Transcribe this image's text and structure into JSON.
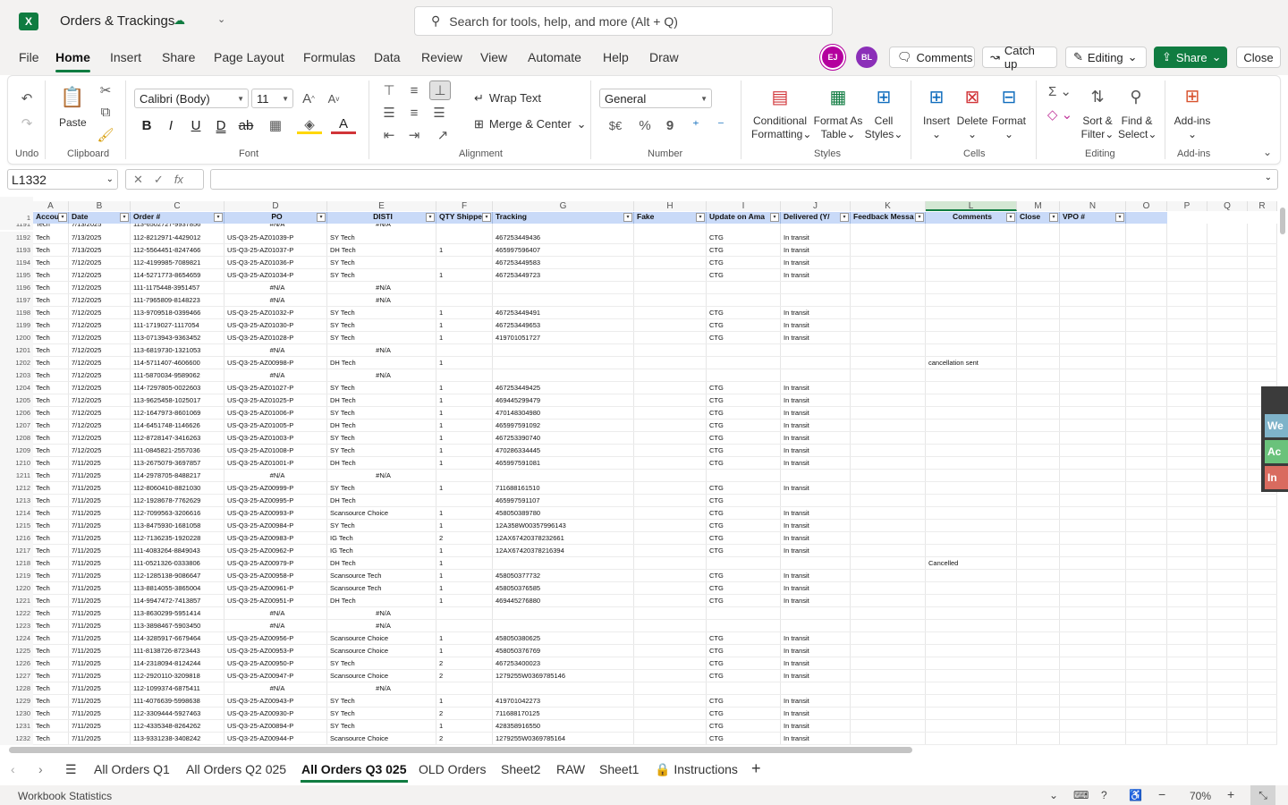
{
  "app": {
    "title": "Orders & Trackings",
    "search_placeholder": "Search for tools, help, and more (Alt + Q)"
  },
  "menu": [
    "File",
    "Home",
    "Insert",
    "Share",
    "Page Layout",
    "Formulas",
    "Data",
    "Review",
    "View",
    "Automate",
    "Help",
    "Draw"
  ],
  "header_buttons": {
    "avatar1": "EJ",
    "avatar2": "BL",
    "comments": "Comments",
    "catchup": "Catch up",
    "editing": "Editing",
    "share": "Share",
    "close": "Close"
  },
  "ribbon": {
    "paste": "Paste",
    "clipboard": "Clipboard",
    "undo": "Undo",
    "font_name": "Calibri (Body)",
    "font_size": "11",
    "font": "Font",
    "wrap": "Wrap Text",
    "merge": "Merge & Center",
    "alignment": "Alignment",
    "numfmt": "General",
    "number": "Number",
    "cond_fmt": "Conditional",
    "cond_fmt2": "Formatting",
    "fmt_table": "Format As",
    "fmt_table2": "Table",
    "cell_styles": "Cell",
    "cell_styles2": "Styles",
    "styles": "Styles",
    "insert": "Insert",
    "delete": "Delete",
    "format": "Format",
    "cells": "Cells",
    "sort": "Sort &",
    "sort2": "Filter",
    "find": "Find &",
    "find2": "Select",
    "editing": "Editing",
    "addins": "Add-ins",
    "addins_grp": "Add-ins"
  },
  "namebox": "L1332",
  "columns": [
    "A",
    "B",
    "C",
    "D",
    "E",
    "F",
    "G",
    "H",
    "I",
    "J",
    "K",
    "L",
    "M",
    "N",
    "O",
    "P",
    "Q",
    "R"
  ],
  "headers": [
    "Accou",
    "Date",
    "Order #",
    "PO",
    "DISTI",
    "QTY Shippe",
    "Tracking",
    "Fake",
    "Update on Ama",
    "Delivered (Y/",
    "Feedback Messa",
    "Comments",
    "Close",
    "VPO #"
  ],
  "rows": [
    [
      "1192",
      "Tech",
      "7/13/2025",
      "112-8212971-4429012",
      "US-Q3-25-AZ01039-P",
      "SY Tech",
      "",
      "467253449436",
      "",
      "CTG",
      "In transit",
      ""
    ],
    [
      "1193",
      "Tech",
      "7/13/2025",
      "112-5564451-8247466",
      "US-Q3-25-AZ01037-P",
      "DH Tech",
      "1",
      "465997596407",
      "",
      "CTG",
      "In transit",
      ""
    ],
    [
      "1194",
      "Tech",
      "7/12/2025",
      "112-4199985-7089821",
      "US-Q3-25-AZ01036-P",
      "SY Tech",
      "",
      "467253449583",
      "",
      "CTG",
      "In transit",
      ""
    ],
    [
      "1195",
      "Tech",
      "7/12/2025",
      "114-5271773-8654659",
      "US-Q3-25-AZ01034-P",
      "SY Tech",
      "1",
      "467253449723",
      "",
      "CTG",
      "In transit",
      ""
    ],
    [
      "1196",
      "Tech",
      "7/12/2025",
      "111-1175448-3951457",
      "#N/A",
      "#N/A",
      "",
      "",
      "",
      "",
      "",
      ""
    ],
    [
      "1197",
      "Tech",
      "7/12/2025",
      "111-7965809-8148223",
      "#N/A",
      "#N/A",
      "",
      "",
      "",
      "",
      "",
      ""
    ],
    [
      "1198",
      "Tech",
      "7/12/2025",
      "113-9709518-0399466",
      "US-Q3-25-AZ01032-P",
      "SY Tech",
      "1",
      "467253449491",
      "",
      "CTG",
      "In transit",
      ""
    ],
    [
      "1199",
      "Tech",
      "7/12/2025",
      "111-1719027-1117054",
      "US-Q3-25-AZ01030-P",
      "SY Tech",
      "1",
      "467253449653",
      "",
      "CTG",
      "In transit",
      ""
    ],
    [
      "1200",
      "Tech",
      "7/12/2025",
      "113-0713943-9363452",
      "US-Q3-25-AZ01028-P",
      "SY Tech",
      "1",
      "419701051727",
      "",
      "CTG",
      "In transit",
      ""
    ],
    [
      "1201",
      "Tech",
      "7/12/2025",
      "113-6819730-1321053",
      "#N/A",
      "#N/A",
      "",
      "",
      "",
      "",
      "",
      ""
    ],
    [
      "1202",
      "Tech",
      "7/12/2025",
      "114-5711407-4606600",
      "US-Q3-25-AZ00998-P",
      "DH Tech",
      "1",
      "",
      "",
      "",
      "",
      "cancellation sent"
    ],
    [
      "1203",
      "Tech",
      "7/12/2025",
      "111-5870034-9589062",
      "#N/A",
      "#N/A",
      "",
      "",
      "",
      "",
      "",
      ""
    ],
    [
      "1204",
      "Tech",
      "7/12/2025",
      "114-7297805-0022603",
      "US-Q3-25-AZ01027-P",
      "SY Tech",
      "1",
      "467253449425",
      "",
      "CTG",
      "In transit",
      ""
    ],
    [
      "1205",
      "Tech",
      "7/12/2025",
      "113-9625458-1025017",
      "US-Q3-25-AZ01025-P",
      "DH Tech",
      "1",
      "469445299479",
      "",
      "CTG",
      "In transit",
      ""
    ],
    [
      "1206",
      "Tech",
      "7/12/2025",
      "112-1647973-8601069",
      "US-Q3-25-AZ01006-P",
      "SY Tech",
      "1",
      "470148304980",
      "",
      "CTG",
      "In transit",
      ""
    ],
    [
      "1207",
      "Tech",
      "7/12/2025",
      "114-6451748-1146626",
      "US-Q3-25-AZ01005-P",
      "DH Tech",
      "1",
      "465997591092",
      "",
      "CTG",
      "In transit",
      ""
    ],
    [
      "1208",
      "Tech",
      "7/12/2025",
      "112-8728147-3416263",
      "US-Q3-25-AZ01003-P",
      "SY Tech",
      "1",
      "467253390740",
      "",
      "CTG",
      "In transit",
      ""
    ],
    [
      "1209",
      "Tech",
      "7/12/2025",
      "111-0845821-2557036",
      "US-Q3-25-AZ01008-P",
      "SY Tech",
      "1",
      "470286334445",
      "",
      "CTG",
      "In transit",
      ""
    ],
    [
      "1210",
      "Tech",
      "7/11/2025",
      "113-2675079-3697857",
      "US-Q3-25-AZ01001-P",
      "DH Tech",
      "1",
      "465997591081",
      "",
      "CTG",
      "In transit",
      ""
    ],
    [
      "1211",
      "Tech",
      "7/11/2025",
      "114-2978705-8488217",
      "#N/A",
      "#N/A",
      "",
      "",
      "",
      "",
      "",
      ""
    ],
    [
      "1212",
      "Tech",
      "7/11/2025",
      "112-8060410-8821030",
      "US-Q3-25-AZ00999-P",
      "SY Tech",
      "1",
      "711688161510",
      "",
      "CTG",
      "In transit",
      ""
    ],
    [
      "1213",
      "Tech",
      "7/11/2025",
      "112-1928678-7762629",
      "US-Q3-25-AZ00995-P",
      "DH Tech",
      "",
      "465997591107",
      "",
      "CTG",
      "",
      ""
    ],
    [
      "1214",
      "Tech",
      "7/11/2025",
      "112-7099563-3206616",
      "US-Q3-25-AZ00993-P",
      "Scansource Choice",
      "1",
      "458050389780",
      "",
      "CTG",
      "In transit",
      ""
    ],
    [
      "1215",
      "Tech",
      "7/11/2025",
      "113-8475930-1681058",
      "US-Q3-25-AZ00984-P",
      "SY Tech",
      "1",
      "12A358W00357996143",
      "",
      "CTG",
      "In transit",
      ""
    ],
    [
      "1216",
      "Tech",
      "7/11/2025",
      "112-7136235-1920228",
      "US-Q3-25-AZ00983-P",
      "IG Tech",
      "2",
      "12AX67420378232661",
      "",
      "CTG",
      "In transit",
      ""
    ],
    [
      "1217",
      "Tech",
      "7/11/2025",
      "111-4083264-8849043",
      "US-Q3-25-AZ00962-P",
      "IG Tech",
      "1",
      "12AX67420378216394",
      "",
      "CTG",
      "In transit",
      ""
    ],
    [
      "1218",
      "Tech",
      "7/11/2025",
      "111-0521326-0333806",
      "US-Q3-25-AZ00979-P",
      "DH Tech",
      "1",
      "",
      "",
      "",
      "",
      "Cancelled"
    ],
    [
      "1219",
      "Tech",
      "7/11/2025",
      "112-1285138-9086647",
      "US-Q3-25-AZ00958-P",
      "Scansource Tech",
      "1",
      "458050377732",
      "",
      "CTG",
      "In transit",
      ""
    ],
    [
      "1220",
      "Tech",
      "7/11/2025",
      "113-8814055-3865004",
      "US-Q3-25-AZ00961-P",
      "Scansource Tech",
      "1",
      "458050376585",
      "",
      "CTG",
      "In transit",
      ""
    ],
    [
      "1221",
      "Tech",
      "7/11/2025",
      "114-9947472-7413857",
      "US-Q3-25-AZ00951-P",
      "DH Tech",
      "1",
      "469445276880",
      "",
      "CTG",
      "In transit",
      ""
    ],
    [
      "1222",
      "Tech",
      "7/11/2025",
      "113-8630299-5951414",
      "#N/A",
      "#N/A",
      "",
      "",
      "",
      "",
      "",
      ""
    ],
    [
      "1223",
      "Tech",
      "7/11/2025",
      "113-3898467-5903450",
      "#N/A",
      "#N/A",
      "",
      "",
      "",
      "",
      "",
      ""
    ],
    [
      "1224",
      "Tech",
      "7/11/2025",
      "114-3285917-6679464",
      "US-Q3-25-AZ00956-P",
      "Scansource Choice",
      "1",
      "458050380625",
      "",
      "CTG",
      "In transit",
      ""
    ],
    [
      "1225",
      "Tech",
      "7/11/2025",
      "111-8138726-8723443",
      "US-Q3-25-AZ00953-P",
      "Scansource Choice",
      "1",
      "458050376769",
      "",
      "CTG",
      "In transit",
      ""
    ],
    [
      "1226",
      "Tech",
      "7/11/2025",
      "114-2318094-8124244",
      "US-Q3-25-AZ00950-P",
      "SY Tech",
      "2",
      "467253400023",
      "",
      "CTG",
      "In transit",
      ""
    ],
    [
      "1227",
      "Tech",
      "7/11/2025",
      "112-2920110-3209818",
      "US-Q3-25-AZ00947-P",
      "Scansource Choice",
      "2",
      "1279255W0369785146",
      "",
      "CTG",
      "In transit",
      ""
    ],
    [
      "1228",
      "Tech",
      "7/11/2025",
      "112-1099374-6875411",
      "#N/A",
      "#N/A",
      "",
      "",
      "",
      "",
      "",
      ""
    ],
    [
      "1229",
      "Tech",
      "7/11/2025",
      "111-4076639-5998638",
      "US-Q3-25-AZ00943-P",
      "SY Tech",
      "1",
      "419701042273",
      "",
      "CTG",
      "In transit",
      ""
    ],
    [
      "1230",
      "Tech",
      "7/11/2025",
      "112-3309444-5927463",
      "US-Q3-25-AZ00930-P",
      "SY Tech",
      "2",
      "711688170125",
      "",
      "CTG",
      "In transit",
      ""
    ],
    [
      "1231",
      "Tech",
      "7/11/2025",
      "112-4335348-8264262",
      "US-Q3-25-AZ00894-P",
      "SY Tech",
      "1",
      "428358916550",
      "",
      "CTG",
      "In transit",
      ""
    ],
    [
      "1232",
      "Tech",
      "7/11/2025",
      "113-9331238-3408242",
      "US-Q3-25-AZ00944-P",
      "Scansource Choice",
      "2",
      "1279255W0369785164",
      "",
      "CTG",
      "In transit",
      ""
    ]
  ],
  "partial_top_row": [
    "1191",
    "Tech",
    "7/13/2025",
    "113-6502727-9937856",
    "#N/A",
    "#N/A"
  ],
  "sheet_tabs": [
    "All Orders Q1",
    "All Orders Q2 025",
    "All Orders Q3 025",
    "OLD Orders",
    "Sheet2",
    "RAW",
    "Sheet1",
    "Instructions"
  ],
  "status": {
    "left": "Workbook Statistics",
    "zoom": "70%"
  },
  "side_tiles": [
    "We",
    "Ac",
    "In"
  ]
}
